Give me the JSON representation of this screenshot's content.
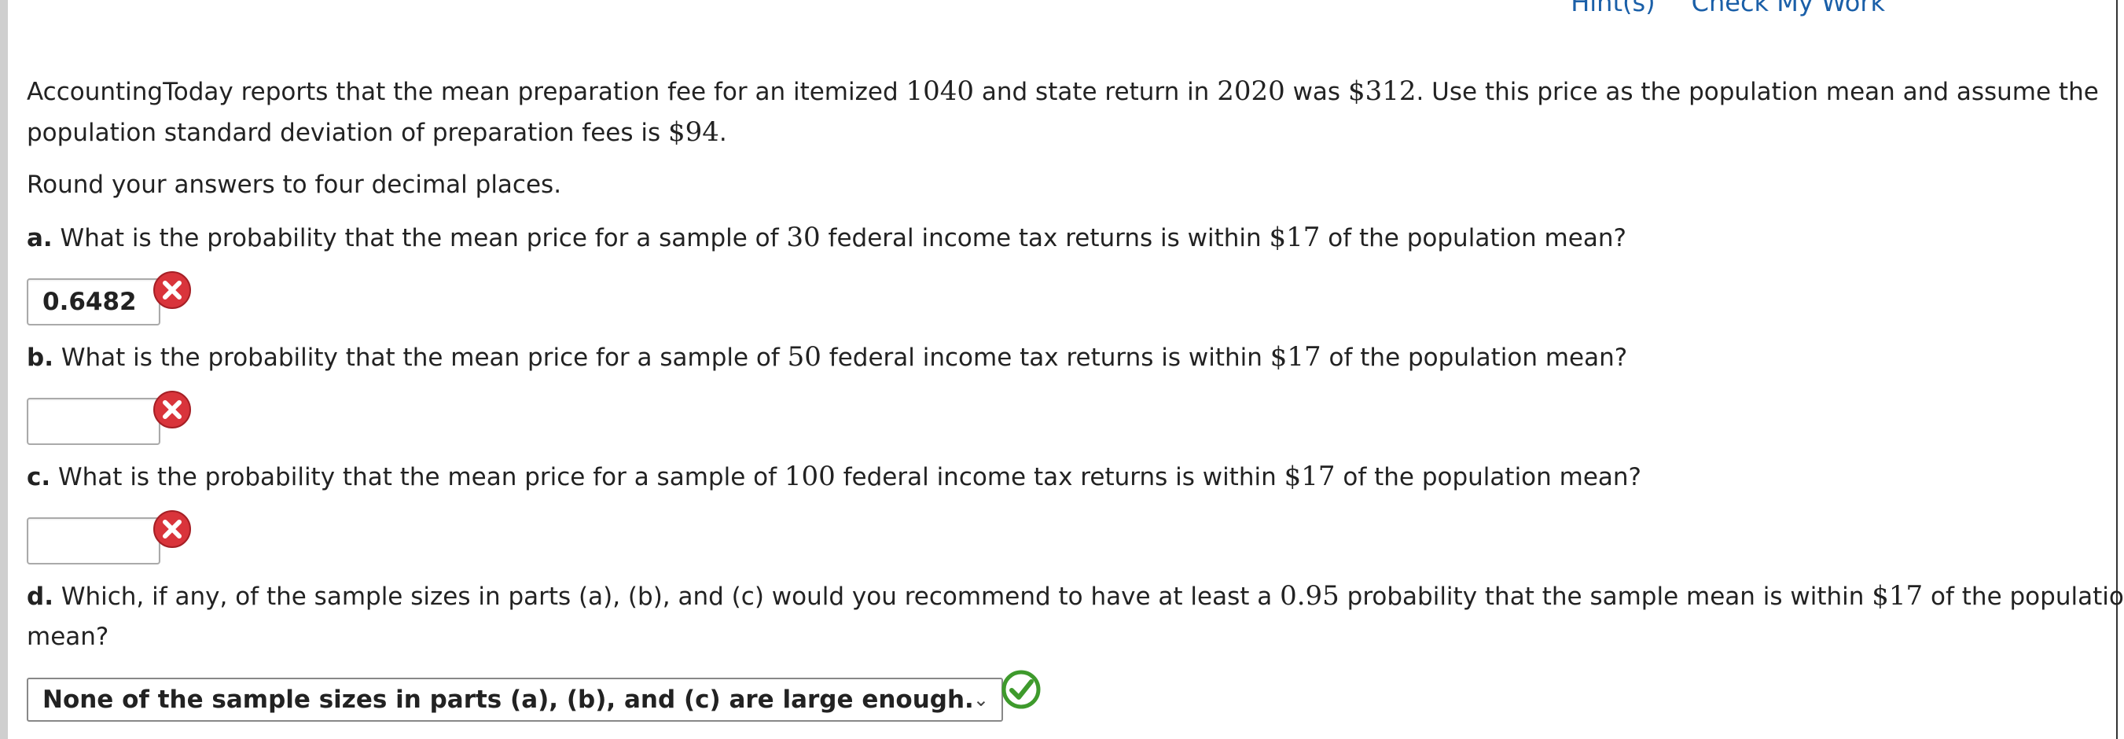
{
  "header": {
    "hints_link": "Hint(s)",
    "check_link": "Check My Work"
  },
  "intro": {
    "t1": "AccountingToday reports that the mean preparation fee for an itemized ",
    "n1": "1040",
    "t2": " and state return in ",
    "n2": "2020",
    "t3": " was ",
    "n3": "$312",
    "t4": ". Use this price as the population mean and assume the",
    "t5": "population standard deviation of preparation fees is ",
    "n4": "$94",
    "t6": "."
  },
  "instruction": "Round your answers to four decimal places.",
  "questions": {
    "a": {
      "label": "a.",
      "t1": " What is the probability that the mean price for a sample of ",
      "n1": "30",
      "t2": " federal income tax returns is within ",
      "n2": "$17",
      "t3": " of the population mean?",
      "answer": "0.6482",
      "status": "incorrect"
    },
    "b": {
      "label": "b.",
      "t1": " What is the probability that the mean price for a sample of ",
      "n1": "50",
      "t2": " federal income tax returns is within ",
      "n2": "$17",
      "t3": " of the population mean?",
      "answer": "",
      "status": "incorrect"
    },
    "c": {
      "label": "c.",
      "t1": " What is the probability that the mean price for a sample of ",
      "n1": "100",
      "t2": " federal income tax returns is within ",
      "n2": "$17",
      "t3": " of the population mean?",
      "answer": "",
      "status": "incorrect"
    },
    "d": {
      "label": "d.",
      "t1": " Which, if any, of the sample sizes in parts (a), (b), and (c) would you recommend to have at least a ",
      "n1": "0.95",
      "t2": " probability that the sample mean is within ",
      "n2": "$17",
      "t3": " of the population",
      "t4": "mean?",
      "selected": "None of the sample sizes in parts (a), (b), and (c) are large enough.",
      "status": "correct"
    }
  },
  "colors": {
    "link": "#1a5fa8",
    "incorrect": "#d9343b",
    "correct": "#3e9a2c"
  }
}
